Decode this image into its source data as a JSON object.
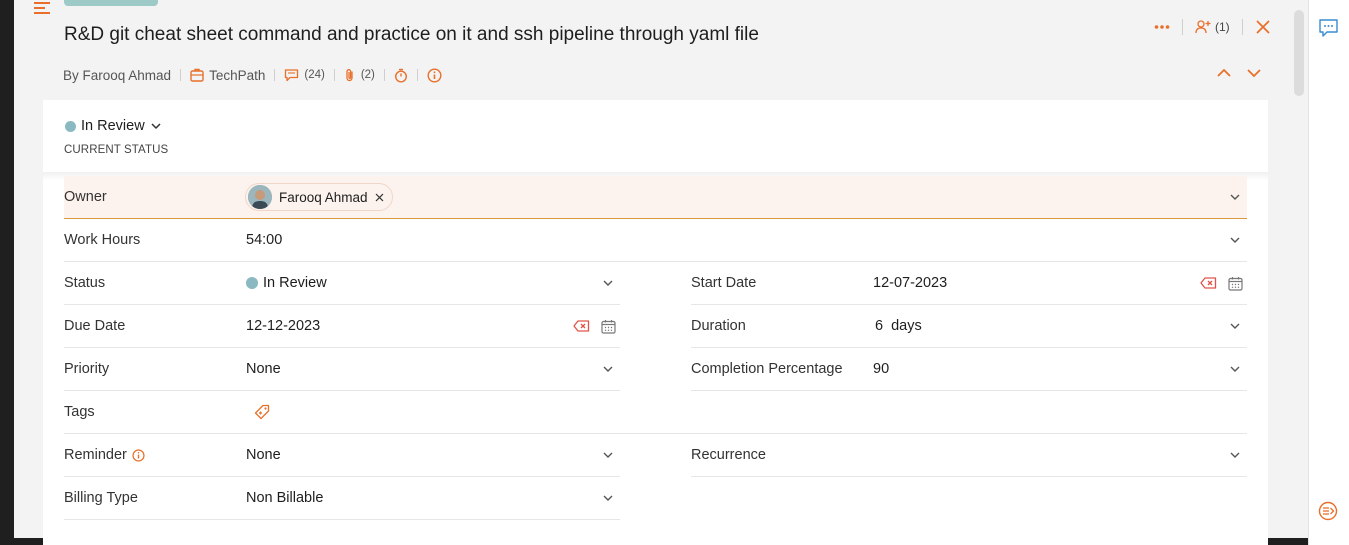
{
  "header": {
    "title": "R&D git cheat sheet command and practice on it and ssh pipeline through yaml file",
    "author": "By Farooq Ahmad",
    "project": "TechPath",
    "comments_count": "(24)",
    "attachments_count": "(2)",
    "followers_count": "(1)"
  },
  "status_block": {
    "value": "In Review",
    "caption": "CURRENT STATUS",
    "color": "#8ab9c1"
  },
  "fields": {
    "owner": {
      "label": "Owner",
      "value": "Farooq Ahmad"
    },
    "work_hours": {
      "label": "Work Hours",
      "value": "54:00"
    },
    "status": {
      "label": "Status",
      "value": "In Review"
    },
    "start_date": {
      "label": "Start Date",
      "value": "12-07-2023"
    },
    "due_date": {
      "label": "Due Date",
      "value": "12-12-2023"
    },
    "duration": {
      "label": "Duration",
      "value": "6  days"
    },
    "priority": {
      "label": "Priority",
      "value": "None"
    },
    "completion": {
      "label": "Completion Percentage",
      "value": "90"
    },
    "tags": {
      "label": "Tags"
    },
    "reminder": {
      "label": "Reminder",
      "value": "None"
    },
    "recurrence": {
      "label": "Recurrence"
    },
    "billing_type": {
      "label": "Billing Type",
      "value": "Non Billable"
    }
  },
  "colors": {
    "accent": "#e8702a",
    "danger": "#e0534a",
    "owner_row_bg": "#fdf3ee",
    "owner_row_border": "#d99a3c",
    "status_dot": "#8ab9c1"
  },
  "icons": [
    "menu-icon",
    "project-icon",
    "comment-icon",
    "attachment-icon",
    "timer-icon",
    "info-icon",
    "more-icon",
    "follower-icon",
    "close-icon",
    "chevron-up-icon",
    "chevron-down-icon",
    "calendar-icon",
    "clear-icon",
    "tag-icon",
    "chat-icon",
    "activity-icon"
  ]
}
